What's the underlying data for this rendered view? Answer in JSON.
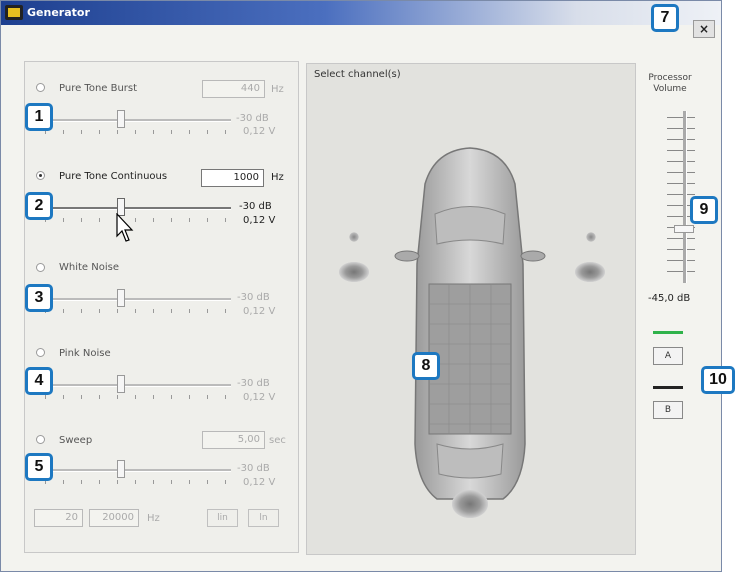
{
  "window": {
    "title": "Generator",
    "close_label": "×"
  },
  "generator": {
    "pure_tone_burst": {
      "label": "Pure Tone Burst",
      "freq": "440",
      "unit": "Hz",
      "db": "-30 dB",
      "volt": "0,12 V"
    },
    "pure_tone_continuous": {
      "label": "Pure Tone Continuous",
      "freq": "1000",
      "unit": "Hz",
      "db": "-30 dB",
      "volt": "0,12 V"
    },
    "white_noise": {
      "label": "White Noise",
      "db": "-30 dB",
      "volt": "0,12 V"
    },
    "pink_noise": {
      "label": "Pink Noise",
      "db": "-30 dB",
      "volt": "0,12 V"
    },
    "sweep": {
      "label": "Sweep",
      "duration": "5,00",
      "duration_unit": "sec",
      "db": "-30 dB",
      "volt": "0,12 V",
      "from": "20",
      "to": "20000",
      "unit": "Hz",
      "btn_lin": "lin",
      "btn_log": "ln"
    }
  },
  "channels": {
    "title": "Select channel(s)"
  },
  "volume": {
    "title": "Processor Volume",
    "value": "-45,0 dB",
    "btn_a": "A",
    "btn_b": "B"
  },
  "callouts": [
    "1",
    "2",
    "3",
    "4",
    "5",
    "7",
    "8",
    "9",
    "10"
  ],
  "colors": {
    "callout_border": "#1d78c1",
    "title_bar": "#1d3f8f",
    "status_green": "#2fb24a"
  }
}
